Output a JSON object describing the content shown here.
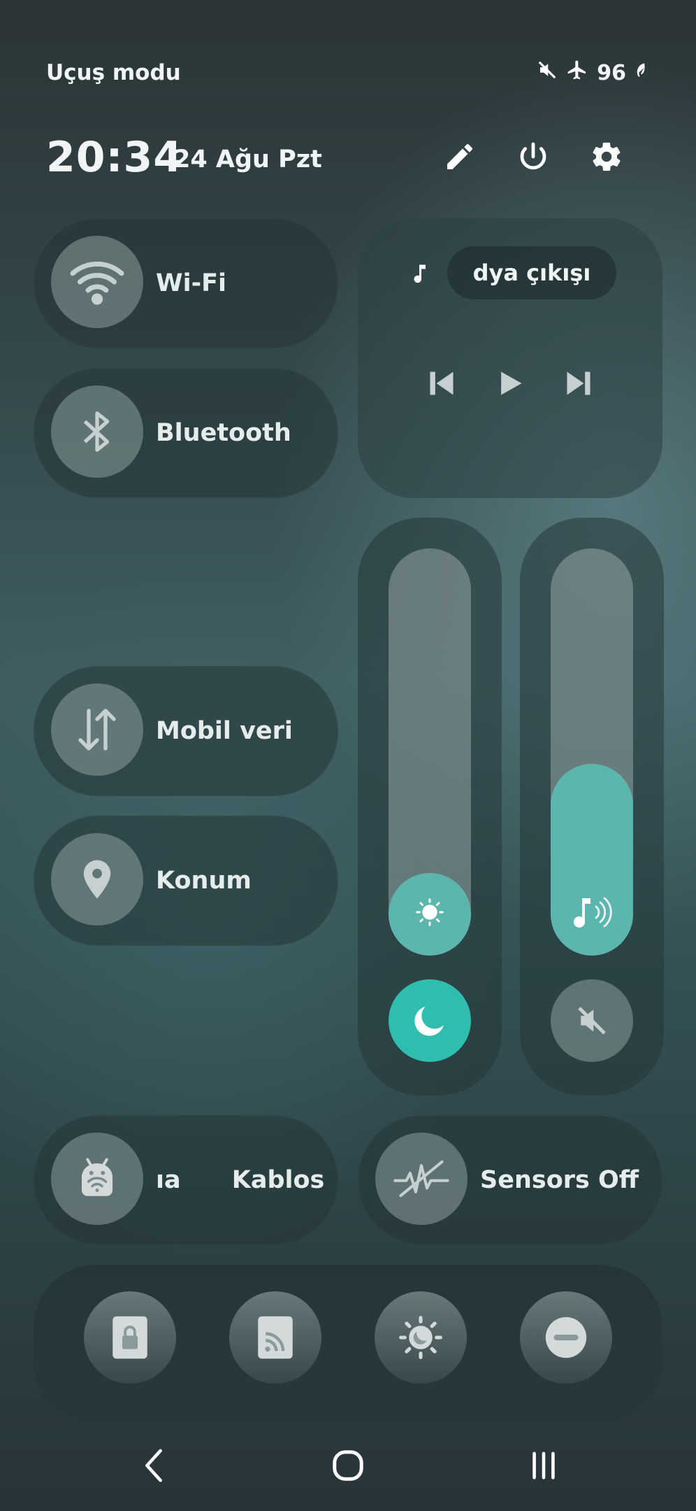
{
  "status_bar": {
    "airplane_mode_label": "Uçuş modu",
    "battery": "96",
    "icons": [
      "mute-icon",
      "airplane-icon",
      "battery-saver-icon"
    ]
  },
  "header": {
    "time": "20:34",
    "date": "24 Ağu Pzt",
    "actions": [
      "edit-icon",
      "power-icon",
      "settings-icon"
    ]
  },
  "tiles": {
    "wifi": "Wi-Fi",
    "bluetooth": "Bluetooth",
    "mobile_data": "Mobil veri",
    "location": "Konum",
    "wireless": "ıa      Kablos",
    "sensors": "Sensors Off"
  },
  "media": {
    "output_label": "dya çıkışı",
    "controls": [
      "previous-icon",
      "play-icon",
      "next-icon"
    ]
  },
  "sliders": {
    "brightness_level": 0.1,
    "volume_level": 0.47,
    "dark_mode_on": true,
    "sound_muted": true
  },
  "bottom_row": [
    "secure-folder-icon",
    "cast-icon",
    "eye-comfort-icon",
    "do-not-disturb-icon"
  ],
  "nav": [
    "back-icon",
    "home-icon",
    "recents-icon"
  ],
  "colors": {
    "accent": "#2fbdb0",
    "fill": "#5cb6ad"
  }
}
